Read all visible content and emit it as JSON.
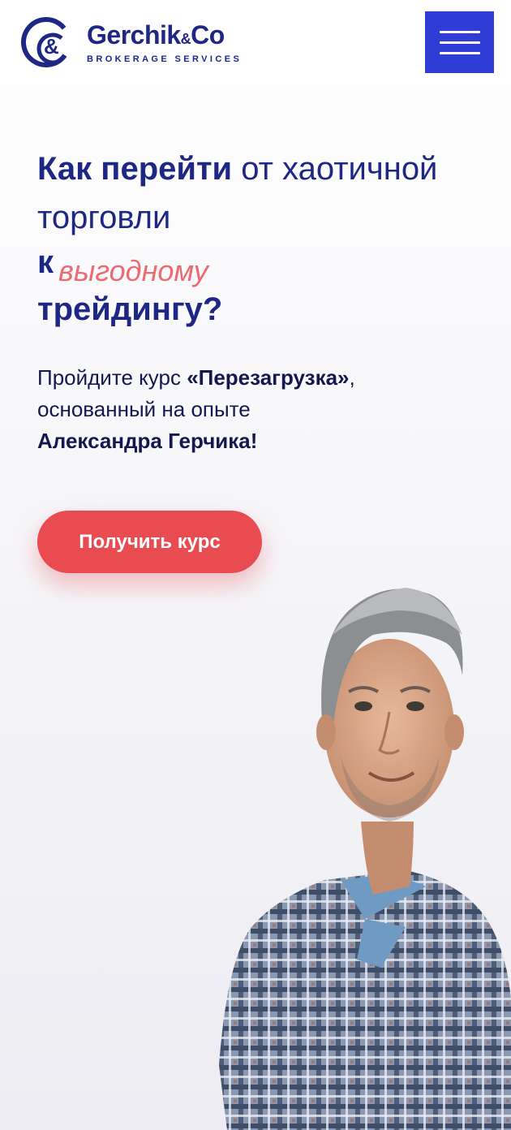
{
  "brand": {
    "name": "Gerchik",
    "amp": "&",
    "name_end": "Co",
    "tagline": "BROKERAGE SERVICES",
    "primary_color": "#1f2785",
    "menu_color": "#2f3cd5",
    "accent_color": "#ec6a72",
    "cta_color": "#e84b50"
  },
  "header": {
    "menu_icon": "hamburger-icon"
  },
  "hero": {
    "headline": {
      "part1_bold": "Как перейти",
      "part1_regular": " от хаотичной",
      "part2_regular": "торговли",
      "part3_bold": "к",
      "part3_accent": "выгодному",
      "part4_bold": "трейдингу?"
    },
    "lead": {
      "line1_regular": "Пройдите курс ",
      "line1_bold": "«Перезагрузка»",
      "line1_end": ",",
      "line2": "основанный на опыте",
      "line3_bold": "Александра Герчика!"
    },
    "cta_label": "Получить курс"
  }
}
